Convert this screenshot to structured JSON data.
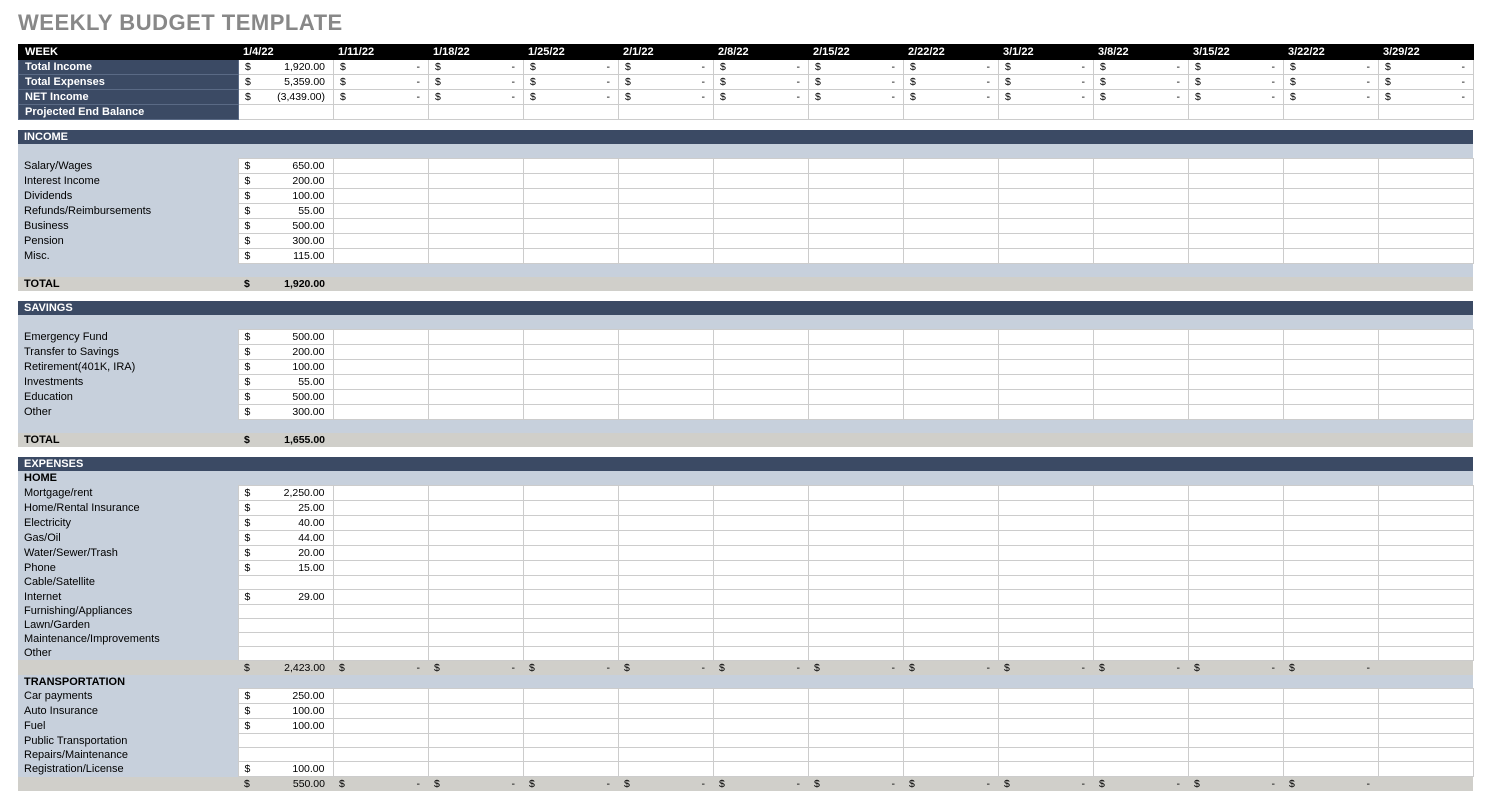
{
  "title": "WEEKLY BUDGET TEMPLATE",
  "dates": [
    "1/4/22",
    "1/11/22",
    "1/18/22",
    "1/25/22",
    "2/1/22",
    "2/8/22",
    "2/15/22",
    "2/22/22",
    "3/1/22",
    "3/8/22",
    "3/15/22",
    "3/22/22",
    "3/29/22"
  ],
  "week_label": "WEEK",
  "summary": [
    {
      "label": "Total Income",
      "values": [
        "1,920.00",
        "-",
        "-",
        "-",
        "-",
        "-",
        "-",
        "-",
        "-",
        "-",
        "-",
        "-",
        "-"
      ]
    },
    {
      "label": "Total Expenses",
      "values": [
        "5,359.00",
        "-",
        "-",
        "-",
        "-",
        "-",
        "-",
        "-",
        "-",
        "-",
        "-",
        "-",
        "-"
      ]
    },
    {
      "label": "NET Income",
      "values": [
        "(3,439.00)",
        "-",
        "-",
        "-",
        "-",
        "-",
        "-",
        "-",
        "-",
        "-",
        "-",
        "-",
        "-"
      ]
    },
    {
      "label": "Projected End Balance",
      "values": [
        "",
        "",
        "",
        "",
        "",
        "",
        "",
        "",
        "",
        "",
        "",
        "",
        ""
      ]
    }
  ],
  "income": {
    "header": "INCOME",
    "rows": [
      {
        "label": "Salary/Wages",
        "values": [
          "650.00"
        ]
      },
      {
        "label": "Interest Income",
        "values": [
          "200.00"
        ]
      },
      {
        "label": "Dividends",
        "values": [
          "100.00"
        ]
      },
      {
        "label": "Refunds/Reimbursements",
        "values": [
          "55.00"
        ]
      },
      {
        "label": "Business",
        "values": [
          "500.00"
        ]
      },
      {
        "label": "Pension",
        "values": [
          "300.00"
        ]
      },
      {
        "label": "Misc.",
        "values": [
          "115.00"
        ]
      }
    ],
    "total_label": "TOTAL",
    "total": "1,920.00"
  },
  "savings": {
    "header": "SAVINGS",
    "rows": [
      {
        "label": "Emergency Fund",
        "values": [
          "500.00"
        ]
      },
      {
        "label": "Transfer to Savings",
        "values": [
          "200.00"
        ]
      },
      {
        "label": "Retirement(401K, IRA)",
        "values": [
          "100.00"
        ]
      },
      {
        "label": "Investments",
        "values": [
          "55.00"
        ]
      },
      {
        "label": "Education",
        "values": [
          "500.00"
        ]
      },
      {
        "label": "Other",
        "values": [
          "300.00"
        ]
      }
    ],
    "total_label": "TOTAL",
    "total": "1,655.00"
  },
  "expenses": {
    "header": "EXPENSES",
    "groups": [
      {
        "name": "HOME",
        "rows": [
          {
            "label": "Mortgage/rent",
            "values": [
              "2,250.00"
            ]
          },
          {
            "label": "Home/Rental Insurance",
            "values": [
              "25.00"
            ]
          },
          {
            "label": "Electricity",
            "values": [
              "40.00"
            ]
          },
          {
            "label": "Gas/Oil",
            "values": [
              "44.00"
            ]
          },
          {
            "label": "Water/Sewer/Trash",
            "values": [
              "20.00"
            ]
          },
          {
            "label": "Phone",
            "values": [
              "15.00"
            ]
          },
          {
            "label": "Cable/Satellite",
            "values": [
              ""
            ]
          },
          {
            "label": "Internet",
            "values": [
              "29.00"
            ]
          },
          {
            "label": "Furnishing/Appliances",
            "values": [
              ""
            ]
          },
          {
            "label": "Lawn/Garden",
            "values": [
              ""
            ]
          },
          {
            "label": "Maintenance/Improvements",
            "values": [
              ""
            ]
          },
          {
            "label": "Other",
            "values": [
              ""
            ]
          }
        ],
        "subtotal": [
          "2,423.00",
          "-",
          "-",
          "-",
          "-",
          "-",
          "-",
          "-",
          "-",
          "-",
          "-",
          "-",
          ""
        ]
      },
      {
        "name": "TRANSPORTATION",
        "rows": [
          {
            "label": "Car payments",
            "values": [
              "250.00"
            ]
          },
          {
            "label": "Auto Insurance",
            "values": [
              "100.00"
            ]
          },
          {
            "label": "Fuel",
            "values": [
              "100.00"
            ]
          },
          {
            "label": "Public Transportation",
            "values": [
              ""
            ]
          },
          {
            "label": "Repairs/Maintenance",
            "values": [
              ""
            ]
          },
          {
            "label": "Registration/License",
            "values": [
              "100.00"
            ]
          }
        ],
        "subtotal": [
          "550.00",
          "-",
          "-",
          "-",
          "-",
          "-",
          "-",
          "-",
          "-",
          "-",
          "-",
          "-",
          ""
        ]
      }
    ]
  }
}
